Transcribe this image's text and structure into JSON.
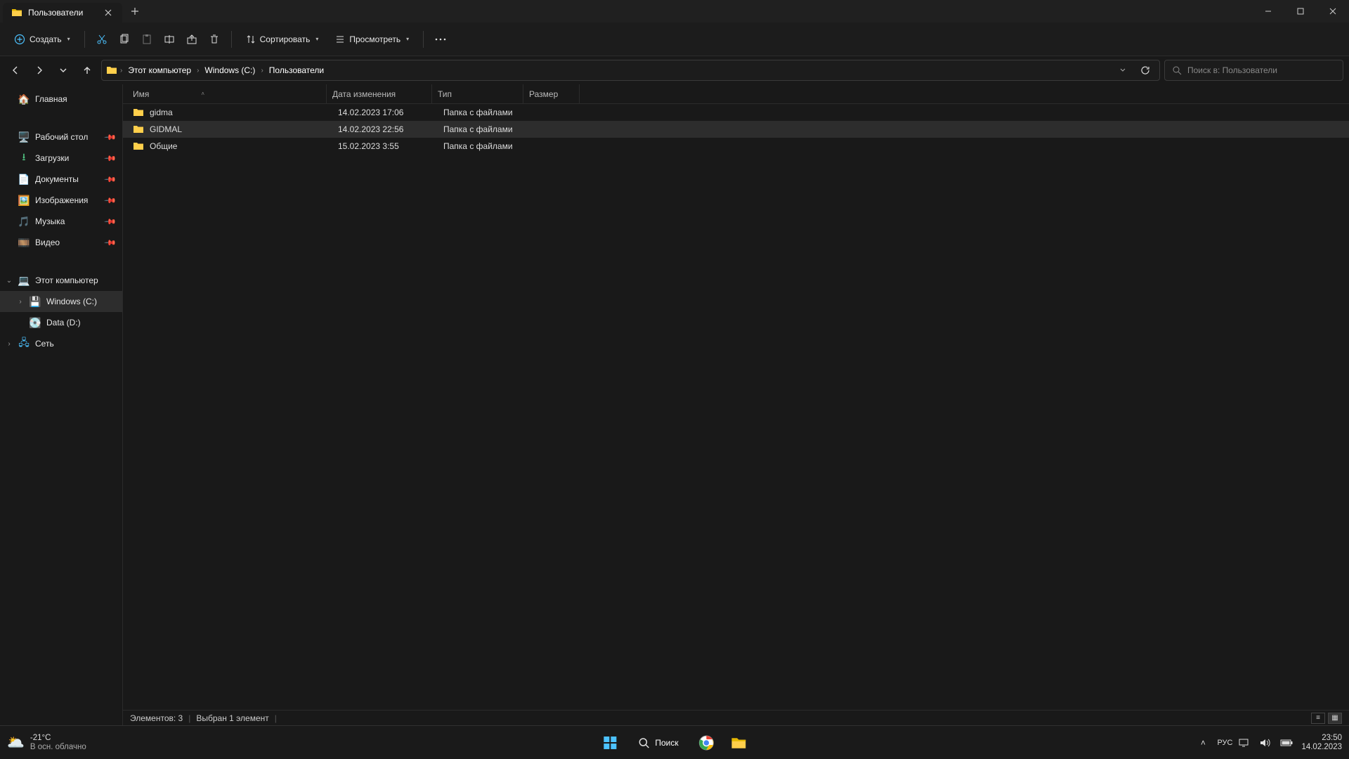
{
  "tab": {
    "title": "Пользователи"
  },
  "toolbar": {
    "create": "Создать",
    "sort": "Сортировать",
    "view": "Просмотреть"
  },
  "breadcrumb": {
    "pc": "Этот компьютер",
    "drive": "Windows (C:)",
    "folder": "Пользователи"
  },
  "search": {
    "placeholder": "Поиск в: Пользователи"
  },
  "sidebar": {
    "home": "Главная",
    "desktop": "Рабочий стол",
    "downloads": "Загрузки",
    "documents": "Документы",
    "pictures": "Изображения",
    "music": "Музыка",
    "videos": "Видео",
    "this_pc": "Этот компьютер",
    "c_drive": "Windows (C:)",
    "d_drive": "Data (D:)",
    "network": "Сеть"
  },
  "columns": {
    "name": "Имя",
    "date": "Дата изменения",
    "type": "Тип",
    "size": "Размер"
  },
  "rows": [
    {
      "name": "gidma",
      "date": "14.02.2023 17:06",
      "type": "Папка с файлами",
      "size": "",
      "selected": false
    },
    {
      "name": "GIDMAL",
      "date": "14.02.2023 22:56",
      "type": "Папка с файлами",
      "size": "",
      "selected": true
    },
    {
      "name": "Общие",
      "date": "15.02.2023 3:55",
      "type": "Папка с файлами",
      "size": "",
      "selected": false
    }
  ],
  "status": {
    "count": "Элементов: 3",
    "selected": "Выбран 1 элемент"
  },
  "taskbar": {
    "temp": "-21°C",
    "weather_desc": "В осн. облачно",
    "search": "Поиск",
    "lang": "РУС",
    "time": "23:50",
    "date": "14.02.2023"
  }
}
